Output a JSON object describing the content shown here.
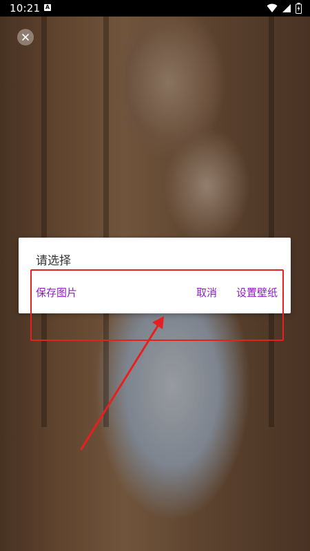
{
  "status_bar": {
    "time": "10:21",
    "icons": [
      "notification-a-icon",
      "wifi-icon",
      "signal-icon",
      "battery-charging-icon"
    ]
  },
  "overlay": {
    "close_icon": "close-icon"
  },
  "dialog": {
    "title": "请选择",
    "buttons": {
      "save": "保存图片",
      "cancel": "取消",
      "set_wallpaper": "设置壁纸"
    },
    "button_color": "#8b1fc4"
  },
  "annotation": {
    "highlight_color": "#e62020"
  }
}
